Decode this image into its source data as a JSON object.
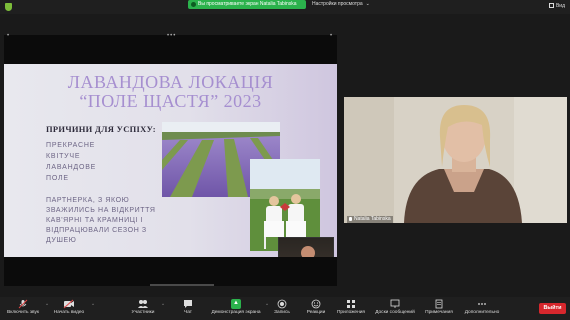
{
  "topbar": {
    "share_status": "Вы просматриваете экран Natalia Tabinska",
    "view_options": "Настройки просмотра",
    "view": "Вид"
  },
  "slide": {
    "title_line1": "ЛАВАНДОВА ЛОКАЦІЯ",
    "title_line2": "“ПОЛЕ ЩАСТЯ” 2023",
    "reasons_title": "ПРИЧИНИ ДЛЯ УСПІХУ:",
    "reasons": [
      "ПРЕКРАСНЕ",
      "КВІТУЧЕ",
      "ЛАВАНДОВЕ",
      "ПОЛЕ"
    ],
    "partner_text": "ПАРТНЕРКА, З ЯКОЮ ЗВАЖИЛИСЬ НА ВІДКРИТТЯ КАВ'ЯРНІ ТА КРАМНИЦІ І ВІДПРАЦЮВАЛИ СЕЗОН З ДУШЕЮ"
  },
  "speaker": {
    "name": "Natalia Tabinska"
  },
  "toolbar": {
    "audio": "Включить звук",
    "video": "Начать видео",
    "participants": "Участники",
    "participants_count": "36",
    "chat": "Чат",
    "screen_share": "Демонстрация экрана",
    "record": "Запись",
    "reactions": "Реакции",
    "apps": "Приложения",
    "whiteboards": "Доски сообщений",
    "notes": "Примечания",
    "more": "Дополнительно",
    "leave": "Выйти"
  },
  "colors": {
    "share_green": "#2bb24c",
    "leave_red": "#d7272d",
    "title_lavender": "#a68fd0"
  }
}
